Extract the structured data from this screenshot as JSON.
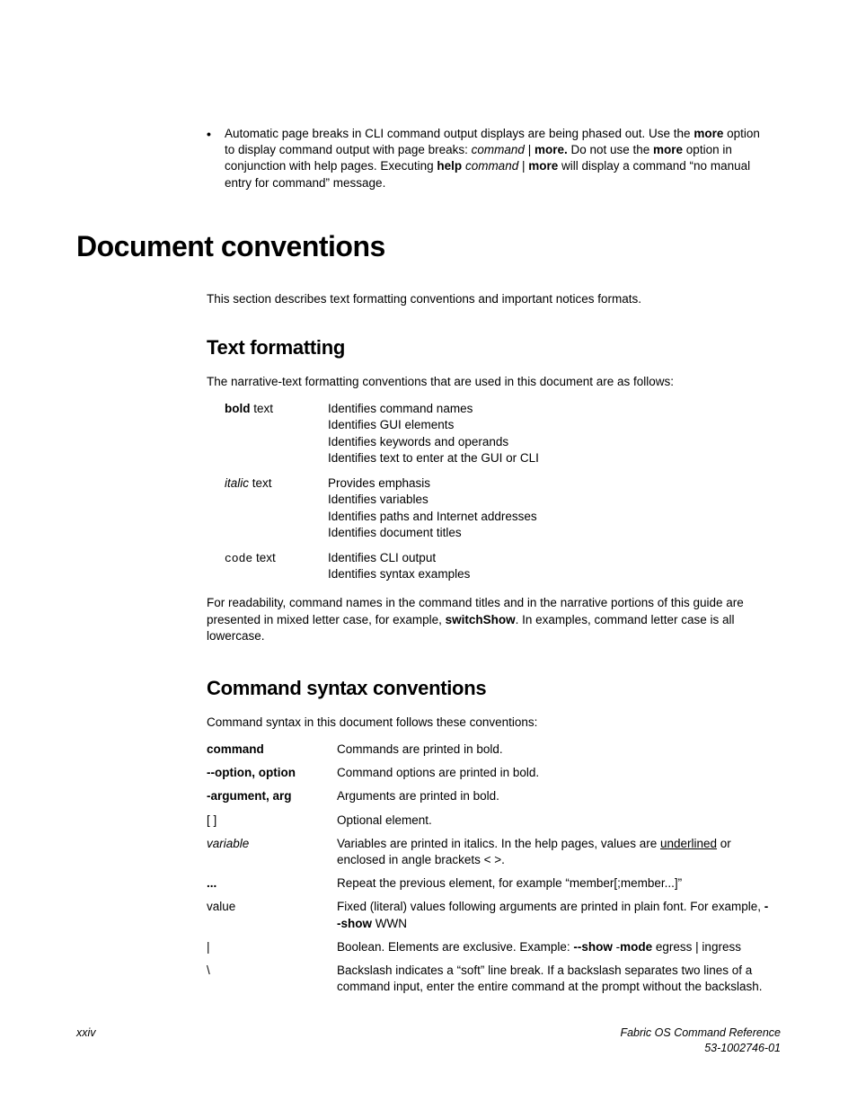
{
  "bullet": {
    "text_parts": [
      "Automatic page breaks in CLI command output displays are being phased out. Use the ",
      "more",
      " option to display command output with page breaks: ",
      "command",
      " | ",
      "more.",
      " Do not use the ",
      "more",
      " option in conjunction with help pages. Executing ",
      "help",
      " ",
      "command",
      " | ",
      "more",
      " will display a command “no manual entry for command” message."
    ]
  },
  "h1": "Document conventions",
  "intro": "This section describes text formatting conventions and important notices formats.",
  "tf": {
    "heading": "Text formatting",
    "intro": "The narrative-text formatting conventions that are used in this document are as follows:",
    "rows": [
      {
        "term_bold": "bold",
        "term_rest": " text",
        "lines": [
          "Identifies command names",
          "Identifies GUI elements",
          "Identifies keywords and operands",
          "Identifies text to enter at the GUI or CLI"
        ]
      },
      {
        "term_italic": "italic",
        "term_rest": " text",
        "lines": [
          "Provides emphasis",
          "Identifies variables",
          "Identifies paths and Internet addresses",
          "Identifies document titles"
        ]
      },
      {
        "term_code": "code",
        "term_rest": " text",
        "lines": [
          "Identifies CLI output",
          "Identifies syntax examples"
        ]
      }
    ],
    "outro_parts": [
      "For readability, command names in the command titles and in the narrative portions of this guide are presented in mixed letter case, for example, ",
      "switchShow",
      ". In examples, command letter case is all lowercase."
    ]
  },
  "sc": {
    "heading": "Command syntax conventions",
    "intro": "Command syntax in this document follows these conventions:",
    "rows": {
      "command": {
        "term": "command",
        "desc": "Commands are printed in bold."
      },
      "option": {
        "term": "--option, option",
        "desc": "Command options are printed in bold."
      },
      "arg": {
        "term": "-argument, arg",
        "desc": "Arguments are printed in bold."
      },
      "bracket": {
        "term": "[ ]",
        "desc": "Optional element."
      },
      "variable": {
        "term": "variable",
        "desc_pre": "Variables are printed in italics. In the help pages, values are ",
        "desc_ul": "underlined",
        "desc_post": " or enclosed in angle brackets < >."
      },
      "ellipsis": {
        "term": "...",
        "desc": "Repeat the previous element, for example “member[;member...]”"
      },
      "value": {
        "term": "value",
        "desc_pre": "Fixed (literal) values following arguments are printed in plain font. For example, ",
        "desc_bold": "--show",
        "desc_post": " WWN"
      },
      "pipe": {
        "term": "|",
        "desc_pre": "Boolean. Elements are exclusive. Example: ",
        "desc_b1": "--show",
        "desc_mid": " -",
        "desc_b2": "mode",
        "desc_post": " egress | ingress"
      },
      "bslash": {
        "term": "\\",
        "desc": "Backslash indicates a “soft” line break. If a backslash separates two lines of a command input, enter the entire command at the prompt without the backslash."
      }
    }
  },
  "footer": {
    "page": "xxiv",
    "title": "Fabric OS Command Reference",
    "docnum": "53-1002746-01"
  }
}
